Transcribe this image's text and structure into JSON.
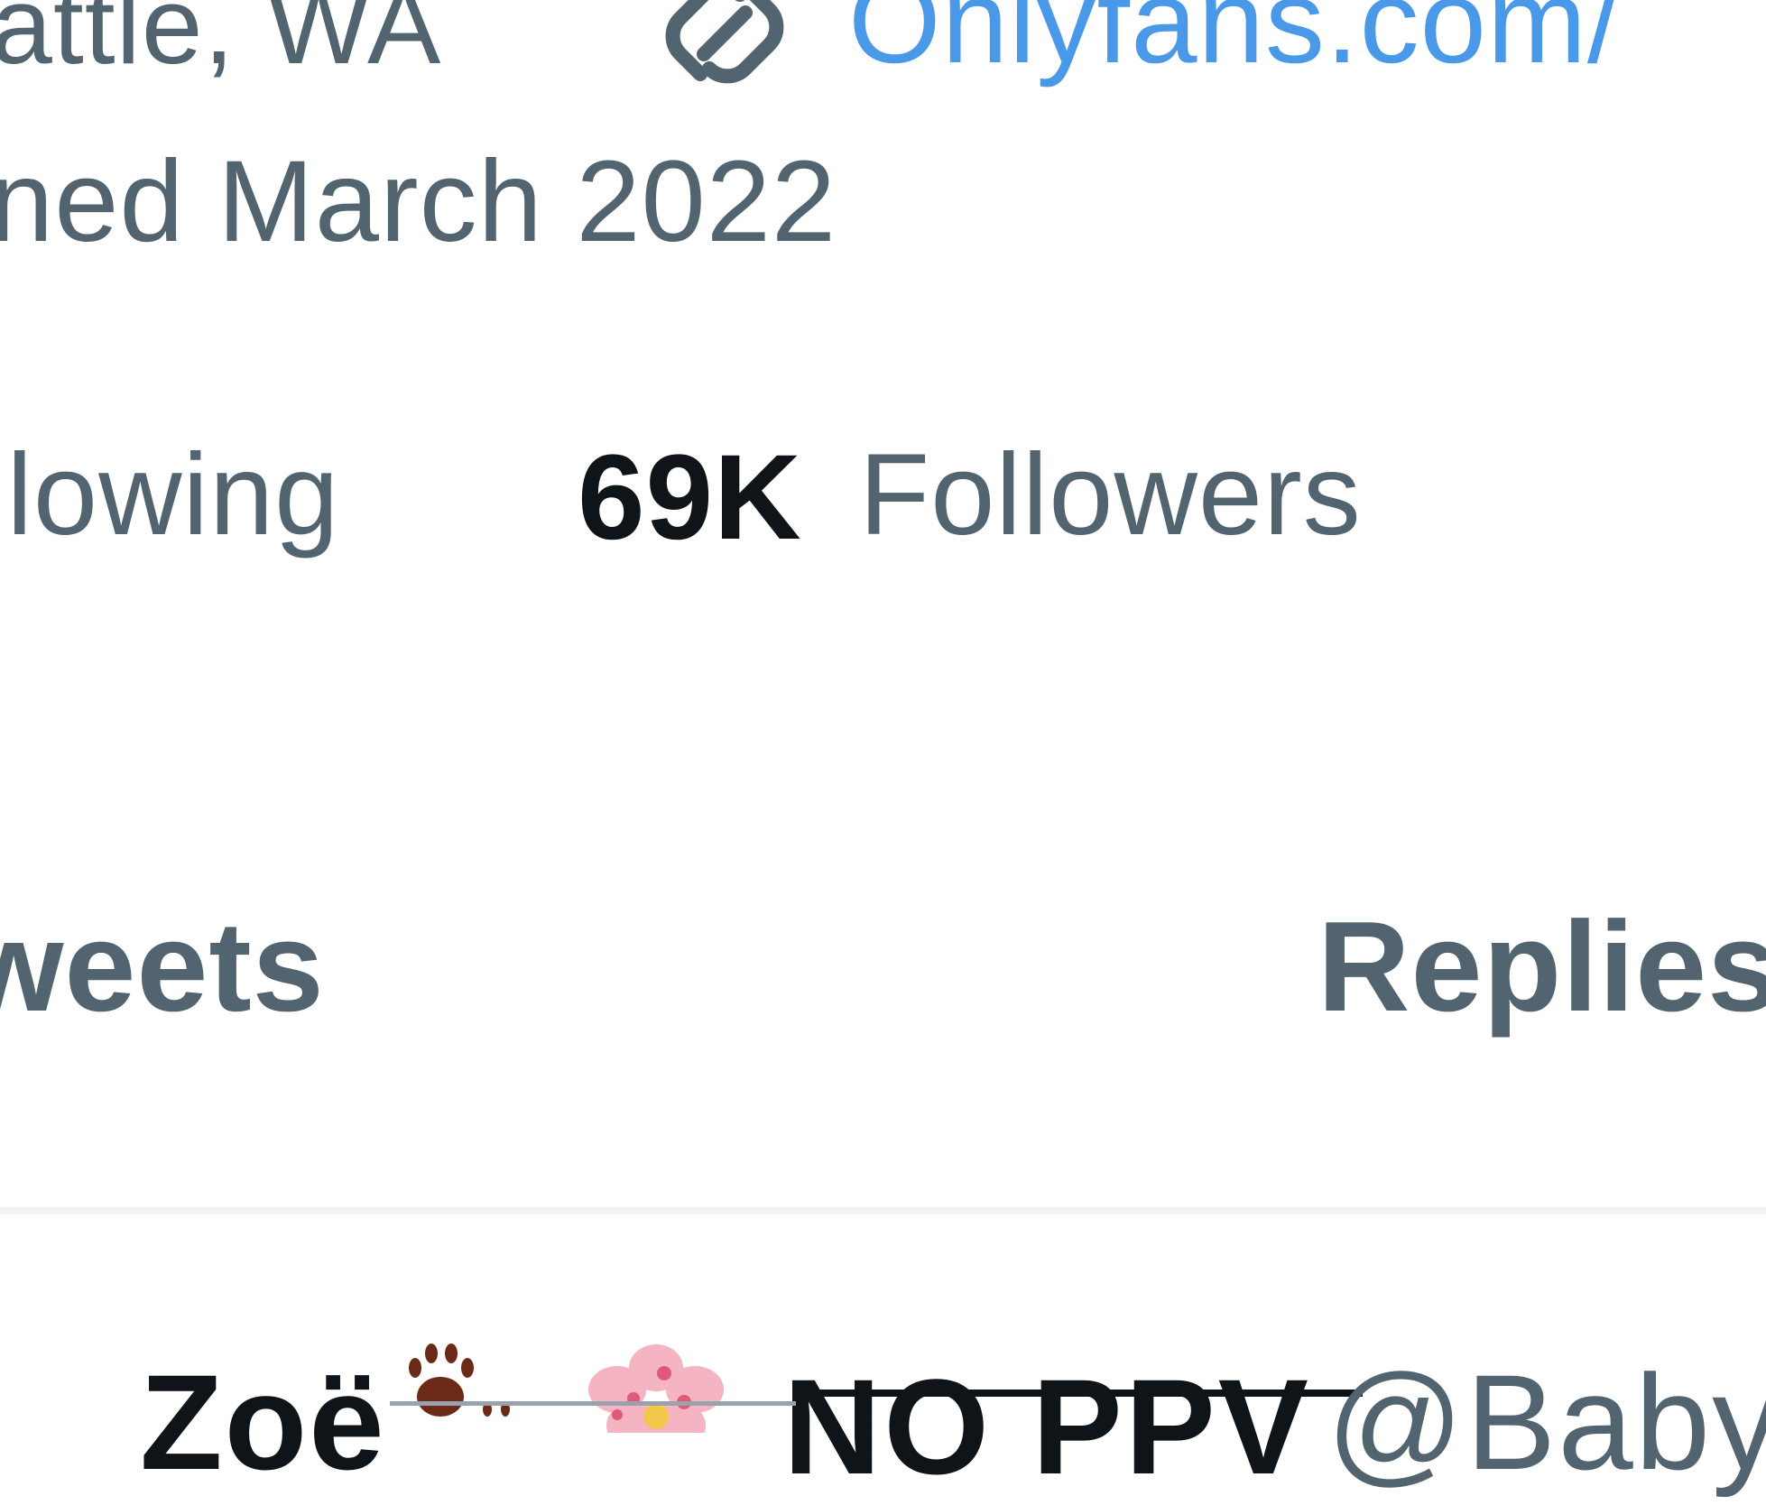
{
  "profile": {
    "location": "attle, WA",
    "website": "Onlyfans.com/",
    "joined": "ned March 2022",
    "following_label": "llowing",
    "followers_count": "69K",
    "followers_label": "Followers"
  },
  "tabs": [
    {
      "label": "weets"
    },
    {
      "label": "Replies"
    }
  ],
  "tweet": {
    "author_name": "Zoë",
    "author_suffix": "NO PPV",
    "handle": "@Baby"
  },
  "icons": {
    "location_link": "link-icon",
    "paw": "paw-prints-icon",
    "blossom": "cherry-blossom-icon"
  },
  "colors": {
    "link": "#4a99e9",
    "secondary_text": "#536471",
    "primary_text": "#0f1419",
    "divider": "#eff3f4"
  }
}
